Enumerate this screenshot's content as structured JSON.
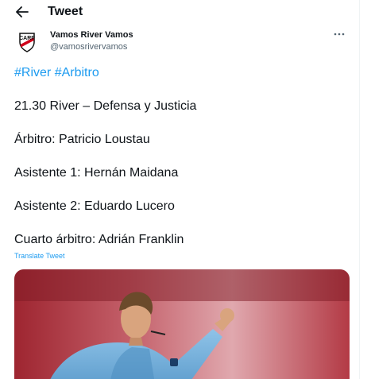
{
  "header": {
    "title": "Tweet",
    "back_icon": "arrow-left-icon"
  },
  "author": {
    "display_name": "Vamos River Vamos",
    "handle": "@vamosrivervamos",
    "avatar_icon": "cabj-river-crest",
    "more_icon": "more-horizontal-icon"
  },
  "tweet": {
    "hashtags": [
      "#River",
      "#Arbitro"
    ],
    "lines": [
      "21.30 River – Defensa y Justicia",
      "Árbitro: Patricio Loustau",
      "Asistente 1: Hernán Maidana",
      "Asistente 2: Eduardo Lucero",
      "Cuarto árbitro: Adrián Franklin"
    ],
    "translate_label": "Translate Tweet"
  },
  "media": {
    "description_icon": "referee-photo"
  },
  "colors": {
    "link": "#1d9bf0",
    "text": "#0f1419",
    "muted": "#536471"
  }
}
